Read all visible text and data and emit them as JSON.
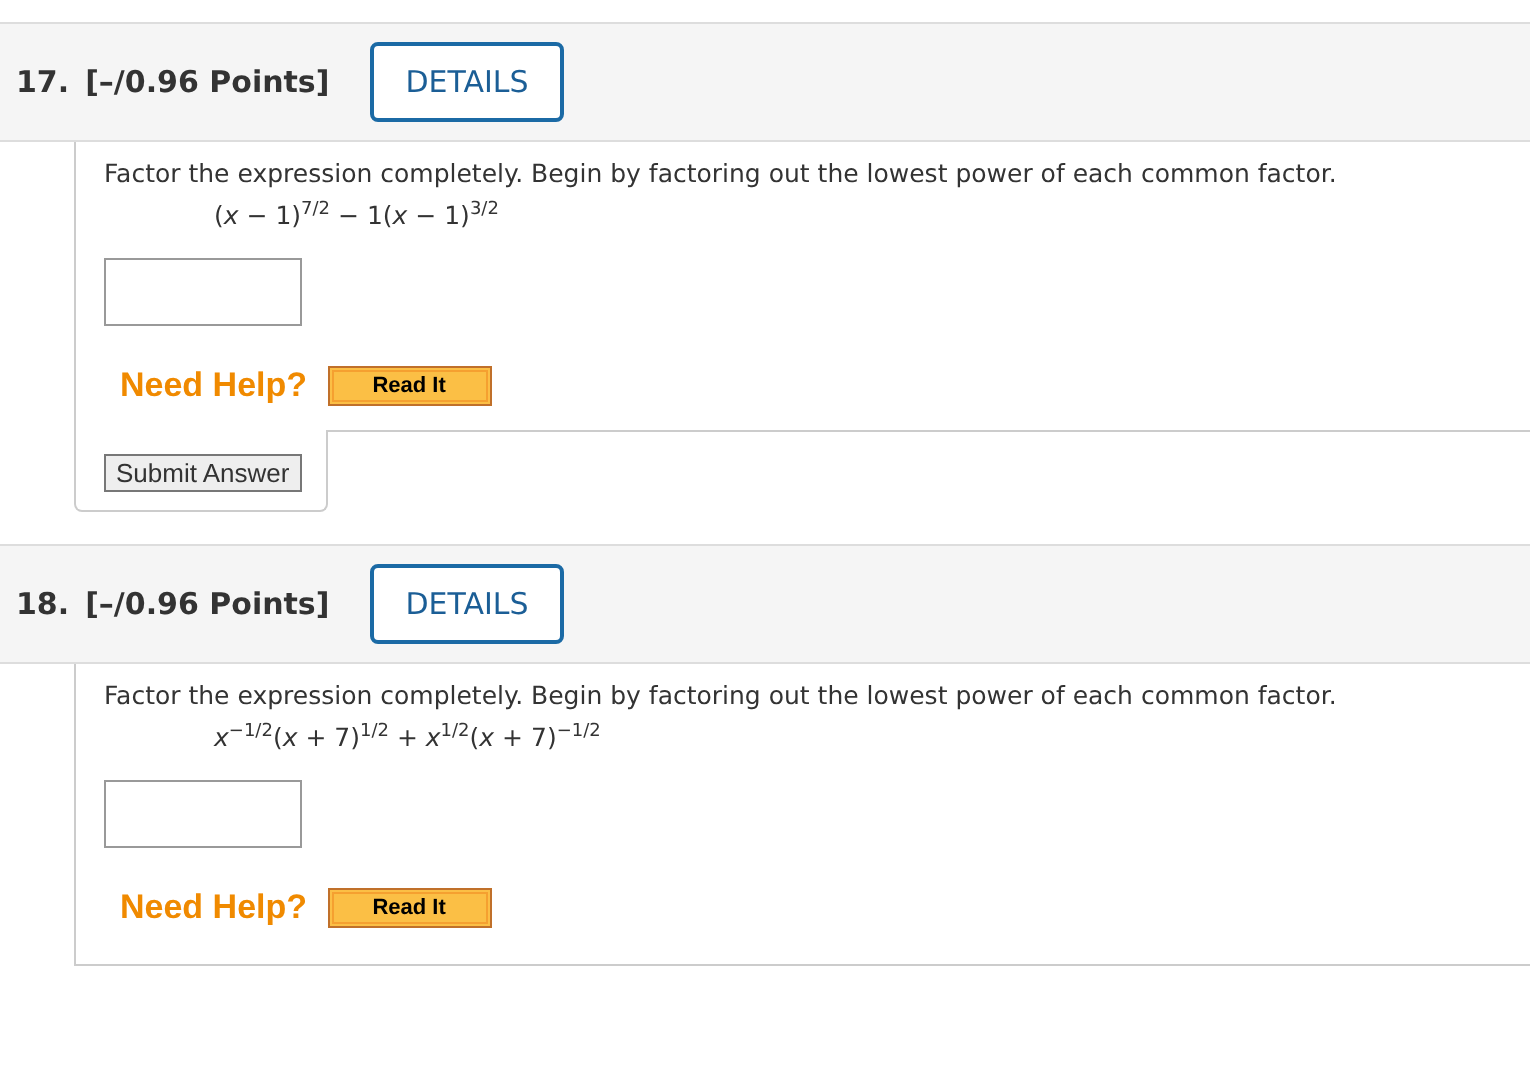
{
  "questions": [
    {
      "number": "17.",
      "points": "[–/0.96 Points]",
      "details_button": "DETAILS",
      "prompt": "Factor the expression completely. Begin by factoring out the lowest power of each common factor.",
      "expression": "(*x* − 1)$^{7/2}$ − 1(*x* − 1)$^{3/2}$",
      "need_help": "Need Help?",
      "read_it_button": "Read It",
      "submit_button": "Submit Answer"
    },
    {
      "number": "18.",
      "points": "[–/0.96 Points]",
      "details_button": "DETAILS",
      "prompt": "Factor the expression completely. Begin by factoring out the lowest power of each common factor.",
      "expression": "*x*$^{−1/2}$(*x* + 7)$^{1/2}$ + *x*$^{1/2}$(*x* + 7)$^{−1/2}$",
      "need_help": "Need Help?",
      "read_it_button": "Read It"
    }
  ]
}
